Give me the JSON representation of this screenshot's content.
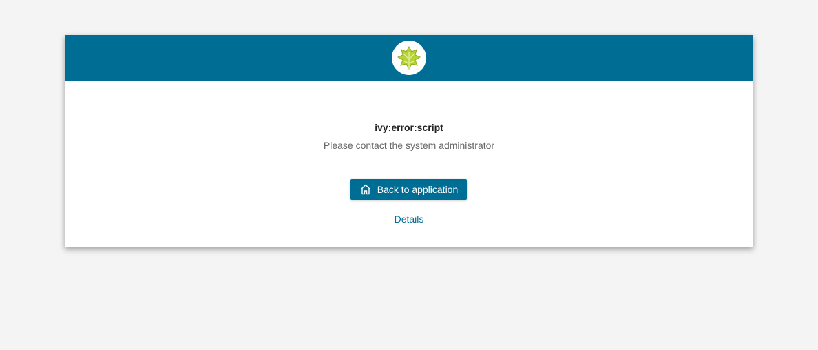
{
  "header": {
    "logo_icon": "ivy-leaf-icon",
    "color": "#006e94"
  },
  "error": {
    "title": "ivy:error:script",
    "message": "Please contact the system administrator"
  },
  "actions": {
    "back_label": "Back to application",
    "back_icon": "home-icon",
    "details_label": "Details"
  },
  "colors": {
    "brand": "#006e94",
    "leaf": "#b5d334",
    "background": "#f4f4f4"
  }
}
